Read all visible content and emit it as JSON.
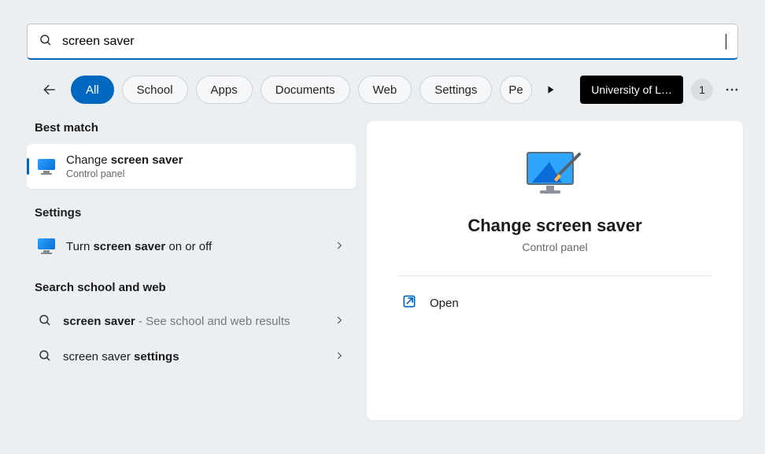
{
  "search": {
    "value": "screen saver"
  },
  "filters": {
    "items": [
      "All",
      "School",
      "Apps",
      "Documents",
      "Web",
      "Settings",
      "Pe"
    ],
    "active_index": 0,
    "org_label": "University of L…",
    "badge_count": "1"
  },
  "left": {
    "best_match_label": "Best match",
    "best_match": {
      "title_pre": "Change ",
      "title_bold": "screen saver",
      "subtitle": "Control panel"
    },
    "settings_label": "Settings",
    "setting1_pre": "Turn ",
    "setting1_bold": "screen saver",
    "setting1_post": " on or off",
    "schoolweb_label": "Search school and web",
    "sw1_bold": "screen saver",
    "sw1_post": " - See school and web results",
    "sw2_pre": "screen saver ",
    "sw2_bold": "settings"
  },
  "right": {
    "title": "Change screen saver",
    "subtitle": "Control panel",
    "open_label": "Open"
  }
}
